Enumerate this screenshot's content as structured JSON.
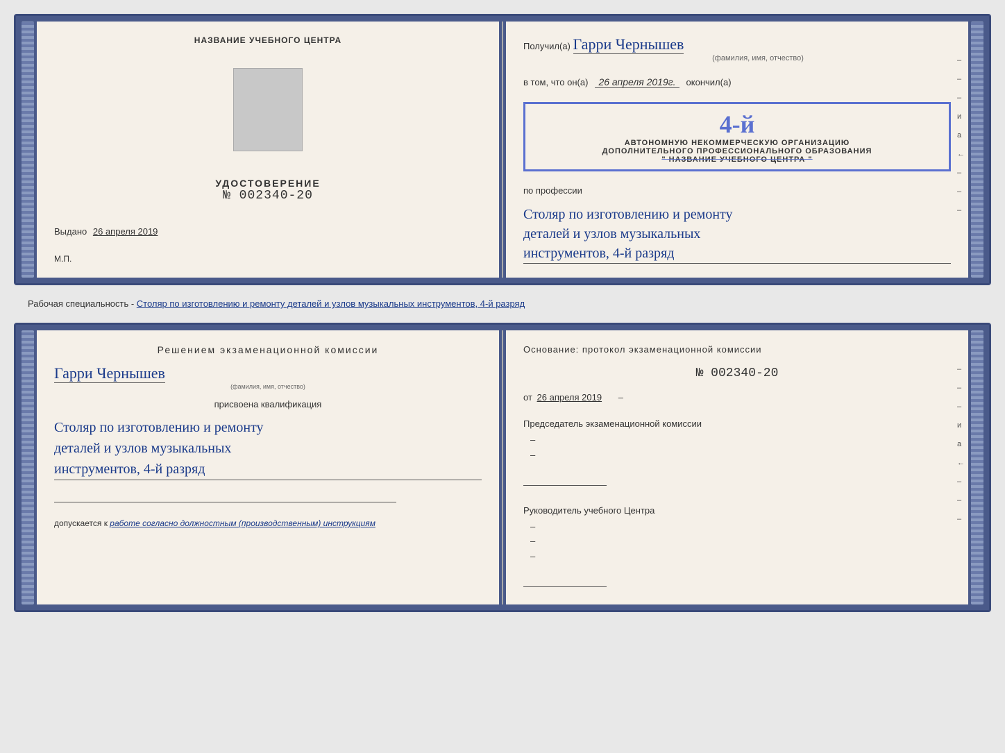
{
  "top_diploma": {
    "left": {
      "title": "НАЗВАНИЕ УЧЕБНОГО ЦЕНТРА",
      "cert_word": "УДОСТОВЕРЕНИЕ",
      "cert_number": "№ 002340-20",
      "issued_label": "Выдано",
      "issued_date": "26 апреля 2019",
      "mp_label": "М.П."
    },
    "right": {
      "received_prefix": "Получил(а)",
      "recipient_name": "Гарри Чернышев",
      "fio_hint": "(фамилия, имя, отчество)",
      "date_prefix": "в том, что он(а)",
      "date_value": "26 апреля 2019г.",
      "date_suffix": "окончил(а)",
      "stamp_grade": "4-й",
      "stamp_line1": "АВТОНОМНУЮ НЕКОММЕРЧЕСКУЮ ОРГАНИЗАЦИЮ",
      "stamp_line2": "ДОПОЛНИТЕЛЬНОГО ПРОФЕССИОНАЛЬНОГО ОБРАЗОВАНИЯ",
      "stamp_line3": "\" НАЗВАНИЕ УЧЕБНОГО ЦЕНТРА \"",
      "profession_label": "по профессии",
      "profession_line1": "Столяр по изготовлению и ремонту",
      "profession_line2": "деталей и узлов музыкальных",
      "profession_line3": "инструментов, 4-й разряд"
    }
  },
  "middle_text": "Рабочая специальность - Столяр по изготовлению и ремонту деталей и узлов музыкальных инструментов, 4-й разряд",
  "bottom_diploma": {
    "left": {
      "decision_title": "Решением  экзаменационной  комиссии",
      "person_name": "Гарри Чернышев",
      "fio_hint": "(фамилия, имя, отчество)",
      "qualification_prefix": "присвоена квалификация",
      "qualification_line1": "Столяр по изготовлению и ремонту",
      "qualification_line2": "деталей и узлов музыкальных",
      "qualification_line3": "инструментов, 4-й разряд",
      "допускается_prefix": "допускается к",
      "допускается_value": "работе согласно должностным (производственным) инструкциям"
    },
    "right": {
      "basis_label": "Основание: протокол экзаменационной  комиссии",
      "protocol_number": "№  002340-20",
      "date_prefix": "от",
      "date_value": "26 апреля 2019",
      "chairman_title": "Председатель экзаменационной комиссии",
      "director_title": "Руководитель учебного Центра"
    }
  }
}
